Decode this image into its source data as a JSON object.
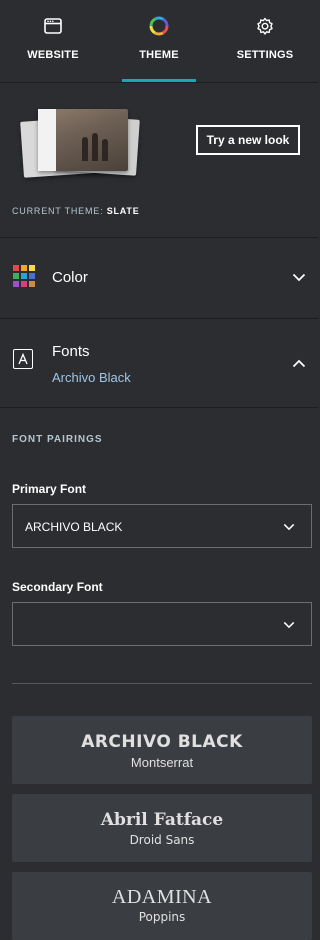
{
  "tabs": [
    {
      "label": "WEBSITE",
      "icon": "browser-window-icon",
      "active": false
    },
    {
      "label": "THEME",
      "icon": "color-wheel-icon",
      "active": true
    },
    {
      "label": "SETTINGS",
      "icon": "gear-icon",
      "active": false
    }
  ],
  "theme": {
    "try_button": "Try a new look",
    "current_label": "CURRENT THEME:",
    "current_value": "SLATE"
  },
  "color_section": {
    "title": "Color",
    "icon": "color-palette-icon",
    "expanded": false
  },
  "fonts_section": {
    "title": "Fonts",
    "subtitle": "Archivo Black",
    "icon": "font-letter-icon",
    "expanded": true
  },
  "font_pairings": {
    "section_label": "FONT PAIRINGS",
    "primary_label": "Primary Font",
    "primary_value": "ARCHIVO BLACK",
    "secondary_label": "Secondary Font",
    "secondary_value": ""
  },
  "pairing_cards": [
    {
      "heading": "ARCHIVO BLACK",
      "subheading": "Montserrat"
    },
    {
      "heading": "Abril Fatface",
      "subheading": "Droid Sans"
    },
    {
      "heading": "ADAMINA",
      "subheading": "Poppins"
    }
  ],
  "colors": {
    "background": "#2b2d30",
    "accent": "#1aa8b8",
    "subtitle": "#9fc6e6",
    "card": "#3a3d42"
  }
}
